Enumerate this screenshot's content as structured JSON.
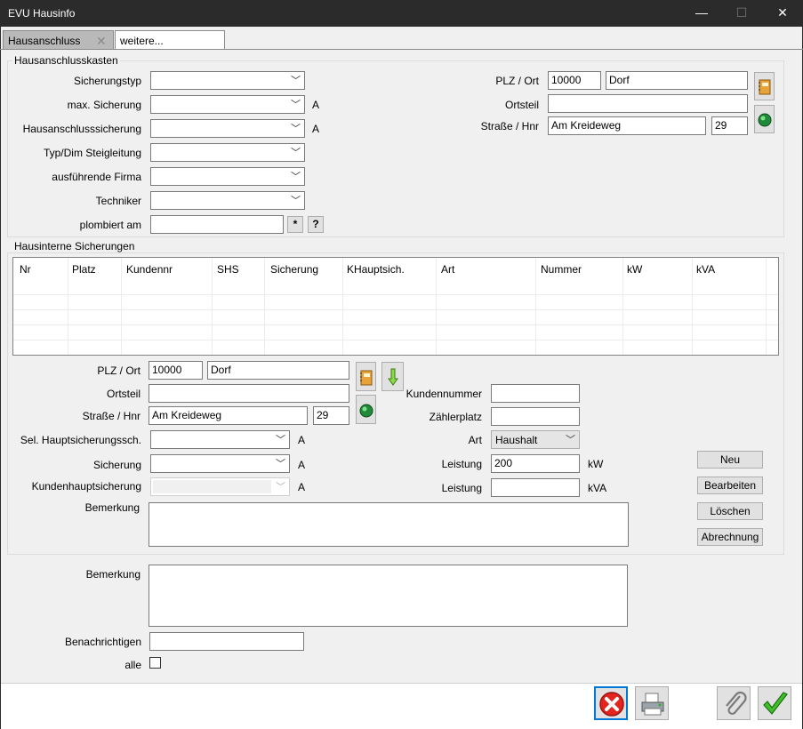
{
  "window": {
    "title": "EVU Hausinfo",
    "minimize": "—",
    "maximize": "☐",
    "close": "✕"
  },
  "tabs": [
    {
      "label": "Hausanschluss",
      "close": "✕"
    },
    {
      "label": "weitere..."
    }
  ],
  "hak": {
    "group_title": "Hausanschlusskasten",
    "sicherungstyp_label": "Sicherungstyp",
    "max_sicherung_label": "max. Sicherung",
    "has_label": "Hausanschlusssicherung",
    "steigleitung_label": "Typ/Dim Steigleitung",
    "firma_label": "ausführende Firma",
    "techniker_label": "Techniker",
    "plombiert_label": "plombiert am",
    "unit_a": "A",
    "star_btn": "*",
    "help_btn": "?",
    "plz_ort_label": "PLZ / Ort",
    "plz": "10000",
    "ort": "Dorf",
    "ortsteil_label": "Ortsteil",
    "ortsteil": "",
    "strasse_label": "Straße / Hnr",
    "strasse": "Am Kreideweg",
    "hnr": "29"
  },
  "his": {
    "group_title": "Hausinterne Sicherungen",
    "columns": [
      "Nr",
      "Platz",
      "Kundennr",
      "SHS",
      "Sicherung",
      "KHauptsich.",
      "Art",
      "Nummer",
      "kW",
      "kVA"
    ],
    "plz_ort_label": "PLZ / Ort",
    "plz": "10000",
    "ort": "Dorf",
    "ortsteil_label": "Ortsteil",
    "ortsteil": "",
    "strasse_label": "Straße / Hnr",
    "strasse": "Am Kreideweg",
    "hnr": "29",
    "sel_label": "Sel. Hauptsicherungssch.",
    "sicherung_label": "Sicherung",
    "khs_label": "Kundenhauptsicherung",
    "bemerkung_label": "Bemerkung",
    "unit_a": "A",
    "kundennummer_label": "Kundennummer",
    "kundennummer": "",
    "zaehlerplatz_label": "Zählerplatz",
    "zaehlerplatz": "",
    "art_label": "Art",
    "art": "Haushalt",
    "leistung_label": "Leistung",
    "leistung_kw": "200",
    "leistung_kva": "",
    "unit_kw": "kW",
    "unit_kva": "kVA",
    "btn_neu": "Neu",
    "btn_bearbeiten": "Bearbeiten",
    "btn_loeschen": "Löschen",
    "btn_abrechnung": "Abrechnung"
  },
  "footer": {
    "bemerkung_label": "Bemerkung",
    "benachrichtigen_label": "Benachrichtigen",
    "benachrichtigen": "",
    "alle_label": "alle"
  },
  "icons": {
    "addressbook": "address-book-icon",
    "globe": "globe-icon",
    "arrow": "arrow-down-icon",
    "cancel": "cancel-icon",
    "print": "printer-icon",
    "attach": "paperclip-icon",
    "ok": "checkmark-icon"
  }
}
